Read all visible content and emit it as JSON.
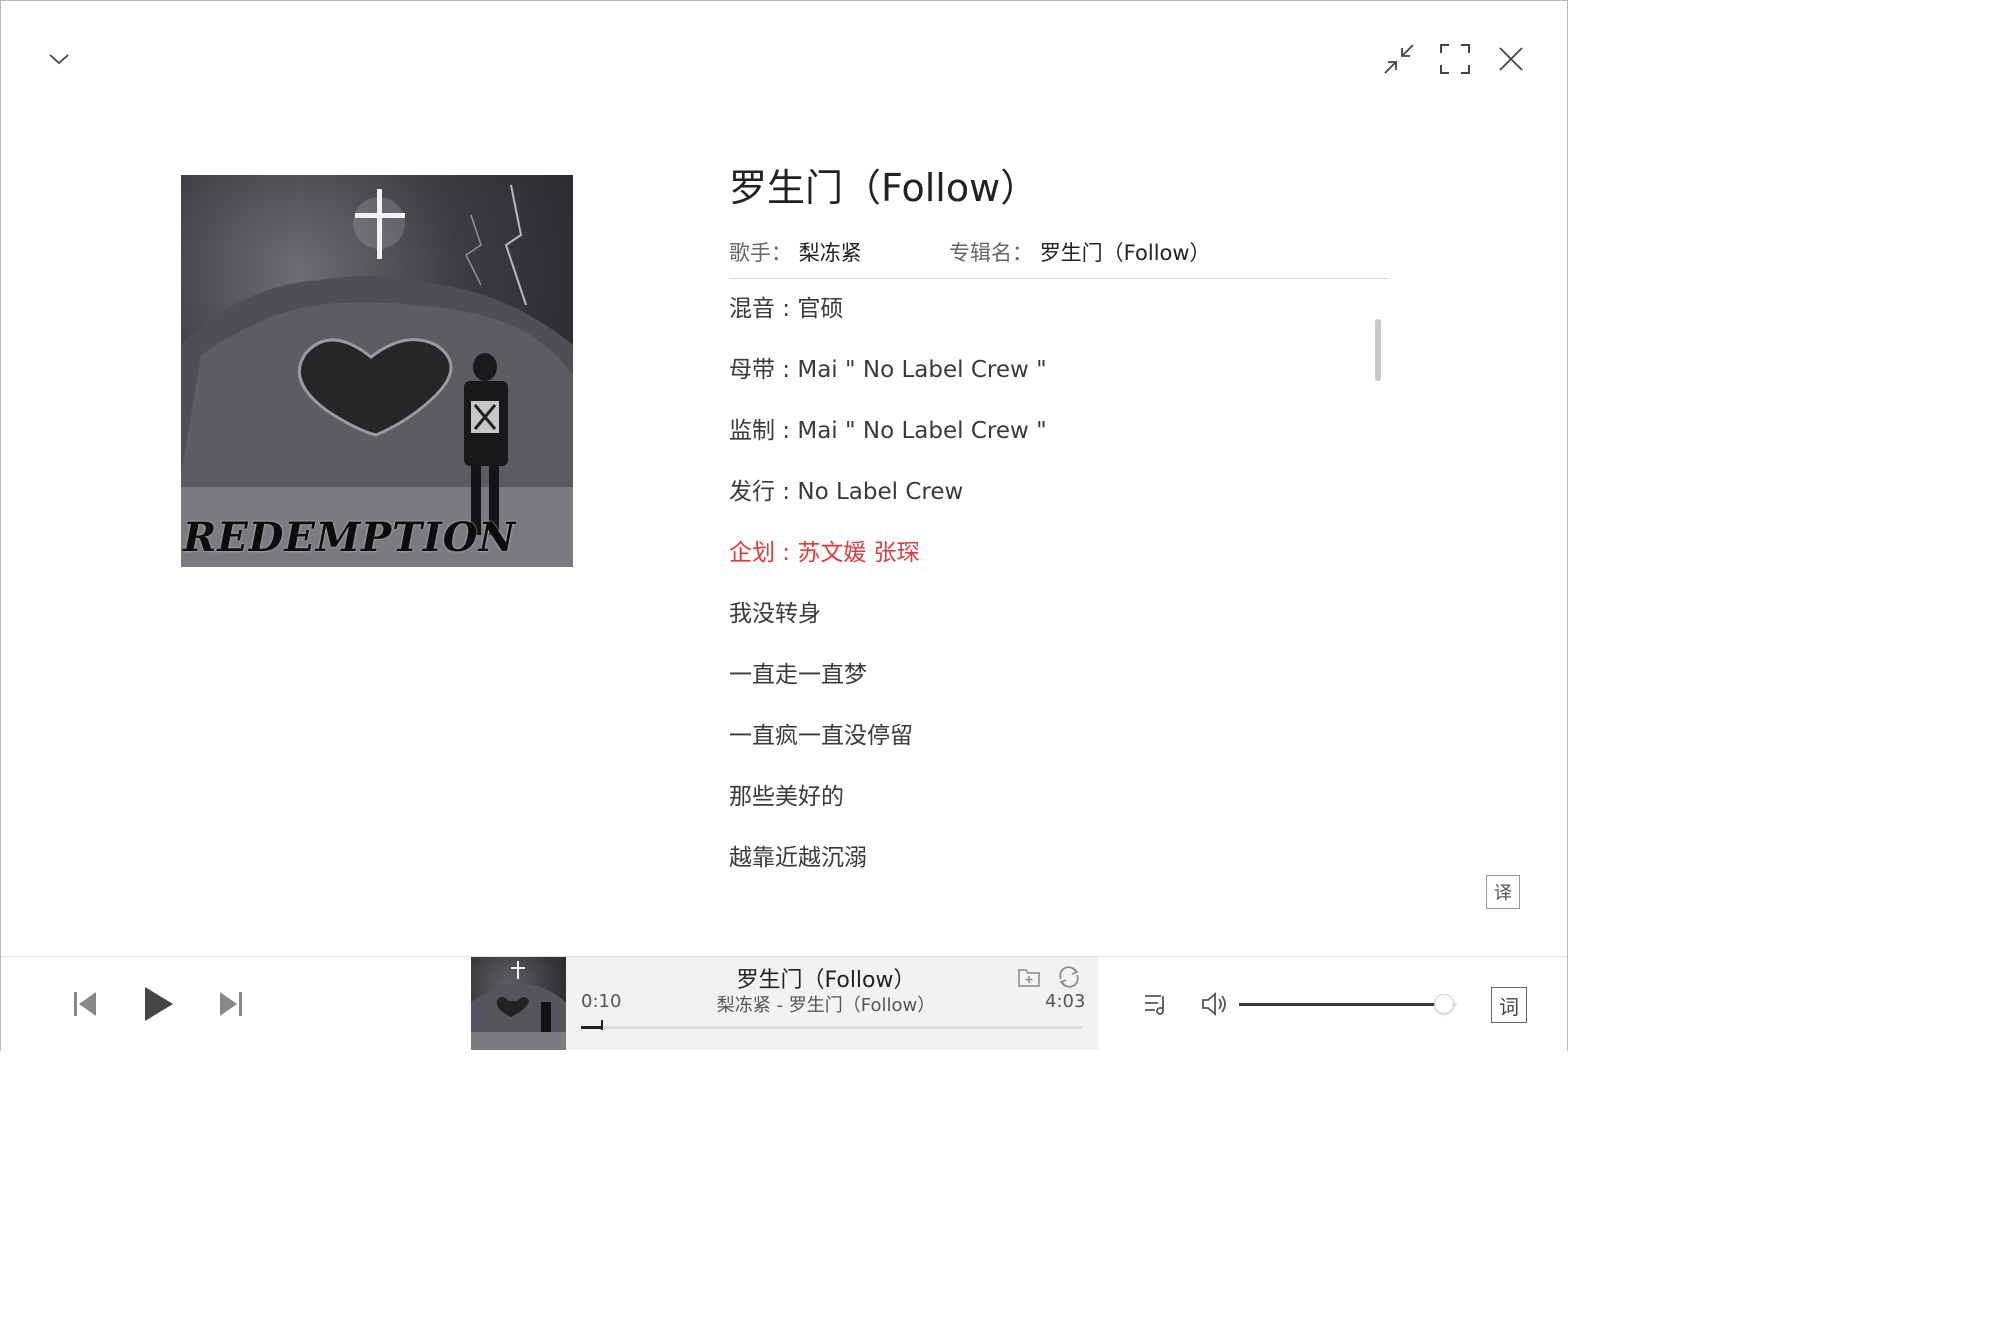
{
  "window": {
    "collapse_icon": "chevron-down-icon",
    "minimize_icon": "exit-fullscreen-icon",
    "maximize_icon": "fullscreen-icon",
    "close_icon": "close-icon"
  },
  "album_art": {
    "caption": "REDEMPTION"
  },
  "song": {
    "title": "罗生门（Follow）",
    "artist_label": "歌手：",
    "artist": "梨冻紧",
    "album_label": "专辑名：",
    "album": "罗生门（Follow）"
  },
  "lyrics": {
    "lines": [
      "混音 : 官硕",
      "母带 : Mai \"  No Label Crew \"",
      "监制 : Mai \"  No Label Crew \"",
      "发行 : No Label Crew",
      "企划 : 苏文媛 张琛",
      "我没转身",
      "一直走一直梦",
      "一直疯一直没停留",
      "那些美好的",
      "越靠近越沉溺"
    ],
    "active_index": 4,
    "active_color": "#e03a3a",
    "translate_label": "译"
  },
  "player": {
    "prev_icon": "skip-previous-icon",
    "play_icon": "play-icon",
    "next_icon": "skip-next-icon",
    "now_playing_title": "罗生门（Follow）",
    "now_playing_subtitle": "梨冻紧 - 罗生门（Follow）",
    "current_time": "0:10",
    "duration": "4:03",
    "progress_fraction": 0.041,
    "add_folder_icon": "add-to-folder-icon",
    "repeat_icon": "repeat-icon",
    "playlist_icon": "playlist-icon",
    "volume_icon": "volume-icon",
    "volume_fraction": 0.94,
    "lyrics_button_label": "词"
  }
}
